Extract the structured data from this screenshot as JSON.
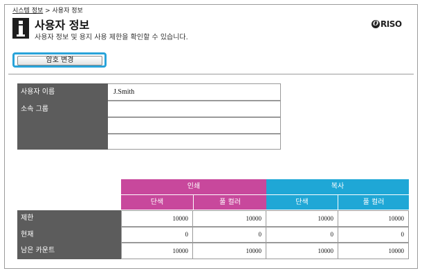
{
  "breadcrumb": {
    "link": "시스템 정보",
    "separator": " > ",
    "current": "사용자 정보"
  },
  "header": {
    "title": "사용자 정보",
    "subtitle": "사용자 정보 및 용지 사용 제한을 확인할 수 있습니다.",
    "logo_mark": "Ö",
    "logo_text": "RISO"
  },
  "actions": {
    "change_password": "암호 변경"
  },
  "user_info": {
    "name_label": "사용자 이름",
    "name_value": "J.Smith",
    "group_label": "소속 그룹",
    "group_values": [
      "",
      "",
      ""
    ]
  },
  "usage": {
    "print_header": "인쇄",
    "copy_header": "복사",
    "mono": "단색",
    "full_color": "풀 컬러",
    "rows": [
      {
        "label": "제한",
        "values": [
          "10000",
          "10000",
          "10000",
          "10000"
        ]
      },
      {
        "label": "현재",
        "values": [
          "0",
          "0",
          "0",
          "0"
        ]
      },
      {
        "label": "남은 카운트",
        "values": [
          "10000",
          "10000",
          "10000",
          "10000"
        ]
      }
    ]
  },
  "colors": {
    "print": "#c8489c",
    "copy": "#1fa7d6",
    "focus": "#29a3d9",
    "label_bg": "#5c5c5c"
  }
}
